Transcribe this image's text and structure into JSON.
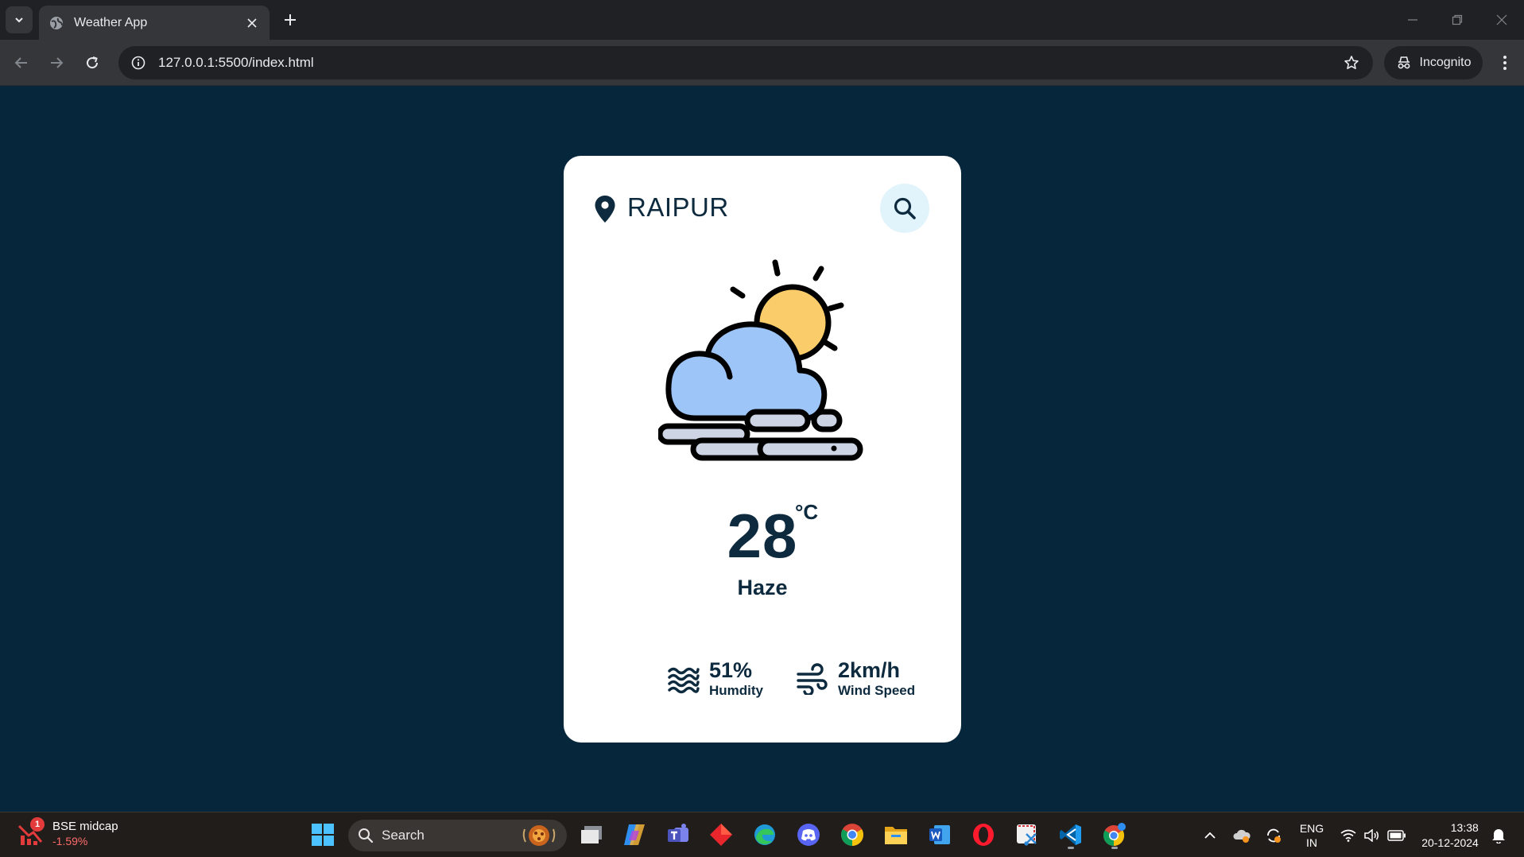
{
  "browser": {
    "tab_title": "Weather App",
    "url": "127.0.0.1:5500/index.html",
    "profile_label": "Incognito"
  },
  "weather": {
    "city": "RAIPUR",
    "temperature": "28",
    "unit": "°C",
    "description": "Haze",
    "humidity": {
      "value": "51%",
      "label": "Humdity"
    },
    "wind": {
      "value": "2km/h",
      "label": "Wind Speed"
    }
  },
  "colors": {
    "page_background": "#05263b",
    "card_background": "#ffffff",
    "text": "#0d2a3e",
    "search_button_bg": "#e1f3fb",
    "sun": "#fbcd6a",
    "cloud": "#9ec5f8",
    "haze": "#cdd5e5"
  },
  "taskbar": {
    "widget": {
      "title": "BSE midcap",
      "change": "-1.59%",
      "badge": "1"
    },
    "search_label": "Search",
    "apps": [
      "task-view",
      "copilot",
      "teams",
      "app-red-diamond",
      "edge",
      "discord",
      "chrome",
      "file-explorer",
      "word",
      "opera",
      "snipping-tool",
      "vscode",
      "chrome-profile"
    ],
    "language": {
      "line1": "ENG",
      "line2": "IN"
    },
    "clock": {
      "time": "13:38",
      "date": "20-12-2024"
    }
  }
}
